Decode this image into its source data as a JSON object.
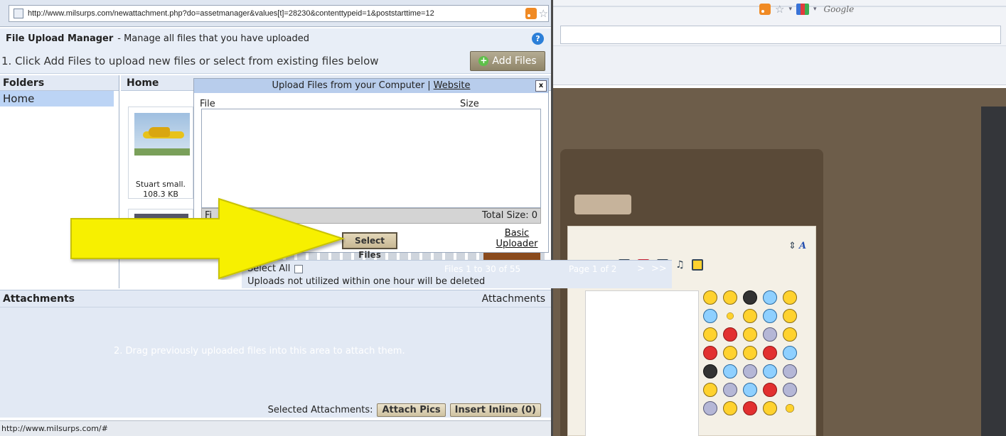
{
  "address_bar": {
    "url": "http://www.milsurps.com/newattachment.php?do=assetmanager&values[t]=28230&contenttypeid=1&poststarttime=12"
  },
  "header": {
    "title": "File Upload Manager",
    "subtitle": "- Manage all files that you have uploaded",
    "help_icon": "?"
  },
  "instructions": {
    "step1": "1. Click Add Files to upload new files or select from existing files below",
    "add_files_label": "Add Files"
  },
  "folders": {
    "header": "Folders",
    "items": [
      "Home"
    ]
  },
  "files": {
    "header": "Home",
    "items": [
      {
        "name": "Stuart small.",
        "size": "108.3 KB"
      }
    ],
    "select_all_label": "Select All",
    "pager_range": "Files 1 to 30 of 55",
    "pager_page": "Page 1 of 2",
    "pager_next": ">",
    "pager_last": ">>",
    "notice": "Uploads not utilized within one hour will be deleted"
  },
  "upload_dialog": {
    "title": "Upload Files from your Computer",
    "separator": "|",
    "website_link": "Website",
    "close_label": "x",
    "col_file": "File",
    "col_size": "Size",
    "files_label": "Fi",
    "total_size": "Total Size: 0",
    "select_files_label": "Select Files",
    "basic_uploader_label": "Basic Uploader"
  },
  "attachments": {
    "header": "Attachments",
    "header_right": "Attachments",
    "drag_message": "2. Drag previously uploaded files into this area to attach them.",
    "selected_label": "Selected Attachments:",
    "attach_pics_label": "Attach Pics",
    "insert_inline_label": "Insert Inline (0)"
  },
  "status_bar": {
    "text": "http://www.milsurps.com/#"
  },
  "background_browser": {
    "search_engine": "Google",
    "toolbar_hash": "#",
    "toolbar_code": "<>",
    "font_size_icon": "A"
  },
  "colors": {
    "arrow_fill": "#f7f000",
    "arrow_stroke": "#c8c200",
    "dialog_title": "#b8cdec",
    "button_tan": "#c8b894",
    "page_bg_brown": "#6d5d4a"
  }
}
